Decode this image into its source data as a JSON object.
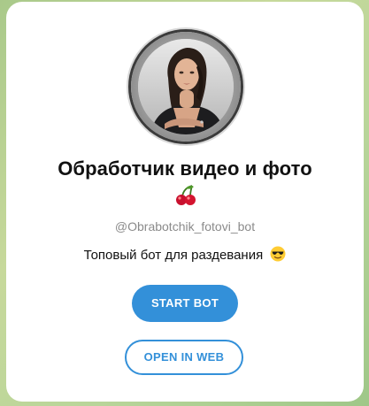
{
  "bot": {
    "title": "Обработчик видео и фото",
    "title_emoji": "cherries-emoji",
    "username": "@Obrabotchik_fotovi_bot",
    "description": "Топовый бот для раздевания",
    "description_emoji": "sunglasses-face-emoji"
  },
  "buttons": {
    "start_label": "START BOT",
    "web_label": "OPEN IN WEB"
  },
  "colors": {
    "accent": "#3390d9",
    "background": "#b8d59a",
    "card": "#ffffff"
  }
}
